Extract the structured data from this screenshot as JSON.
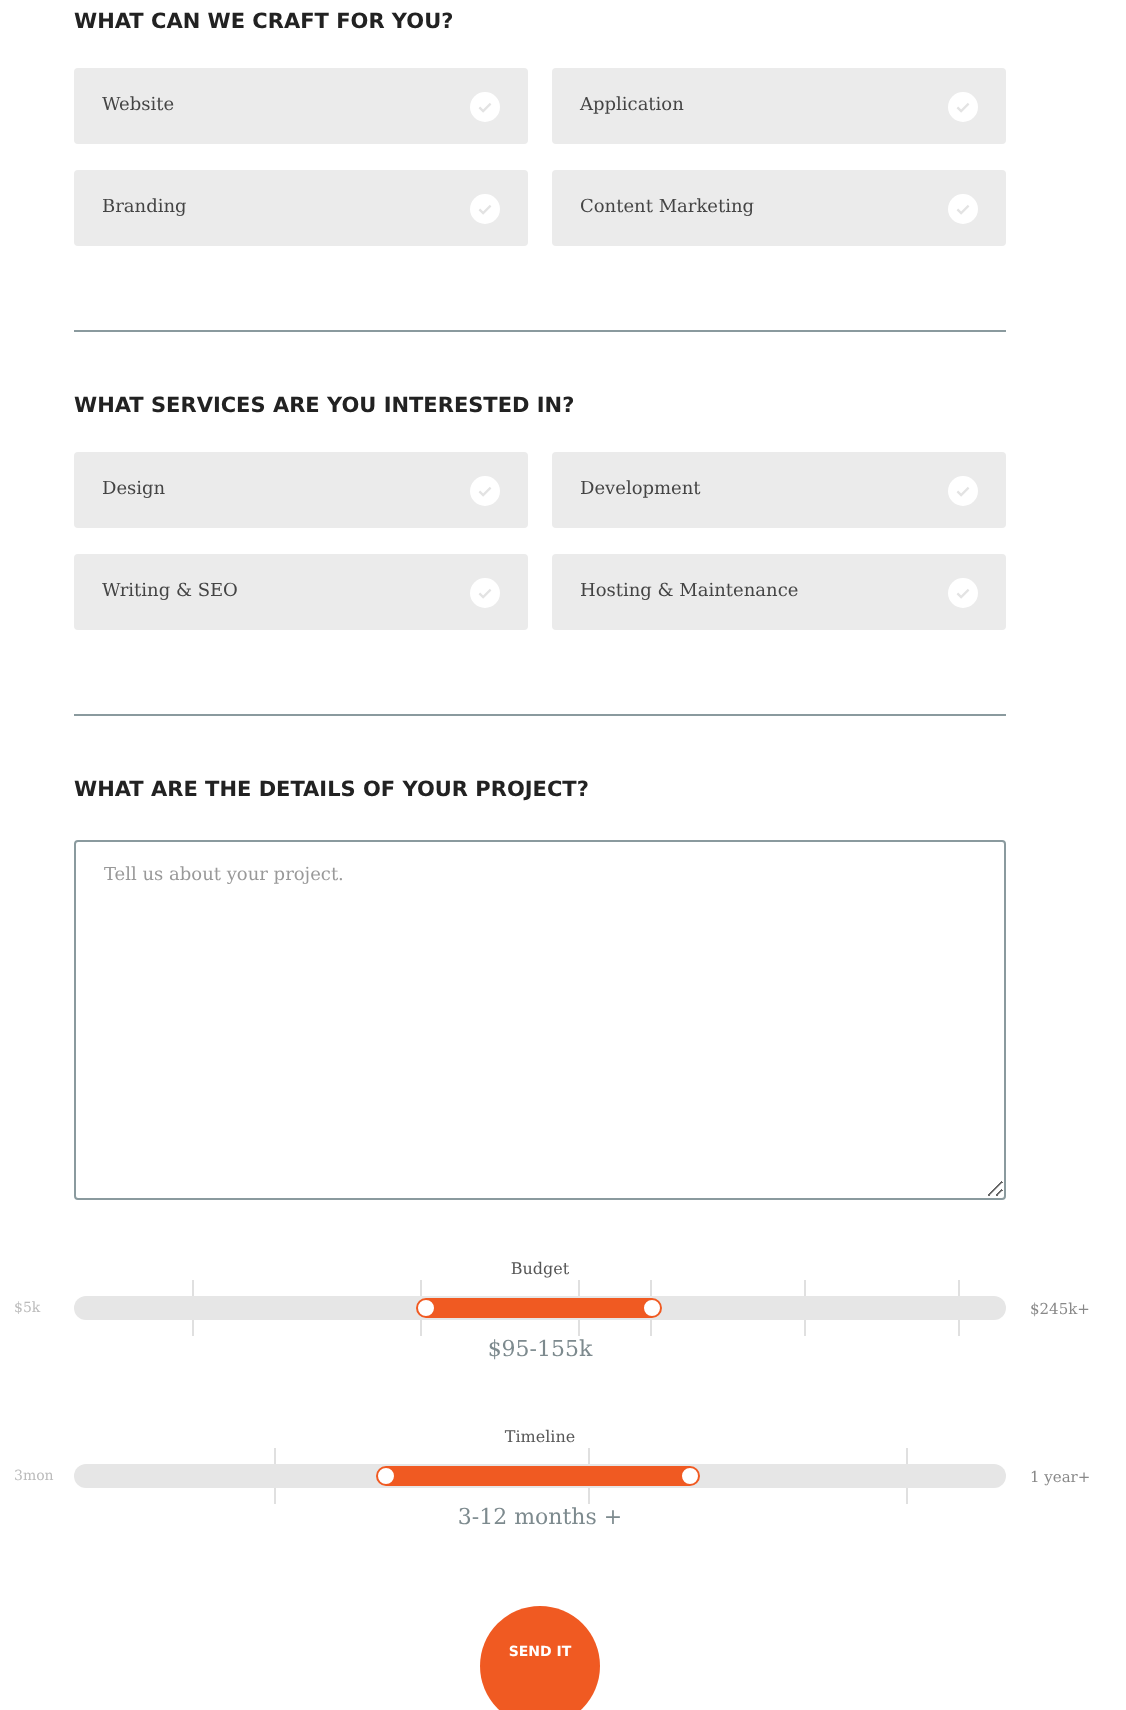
{
  "sections": [
    {
      "heading": "WHAT CAN WE CRAFT FOR YOU?",
      "options": [
        {
          "label": "Website",
          "checked": false
        },
        {
          "label": "Application",
          "checked": false
        },
        {
          "label": "Branding",
          "checked": false
        },
        {
          "label": "Content Marketing",
          "checked": false
        }
      ]
    },
    {
      "heading": "WHAT SERVICES ARE YOU INTERESTED IN?",
      "options": [
        {
          "label": "Design",
          "checked": false
        },
        {
          "label": "Development",
          "checked": false
        },
        {
          "label": "Writing & SEO",
          "checked": false
        },
        {
          "label": "Hosting & Maintenance",
          "checked": false
        }
      ]
    }
  ],
  "details": {
    "heading": "WHAT ARE THE DETAILS OF YOUR PROJECT?",
    "placeholder": "Tell us about your project."
  },
  "sliders": [
    {
      "label": "Budget",
      "min_label": "$5k",
      "max_label": "$245k+",
      "reading": "$95-155k",
      "handles": [
        {
          "level": 0.378
        },
        {
          "level": 0.62
        }
      ]
    },
    {
      "label": "Timeline",
      "min_label": "3mon",
      "max_label": "1 year+",
      "reading": "3-12 months +",
      "handles": [
        {
          "level": 0.335
        },
        {
          "level": 0.661
        }
      ]
    }
  ],
  "submit": "SEND IT"
}
